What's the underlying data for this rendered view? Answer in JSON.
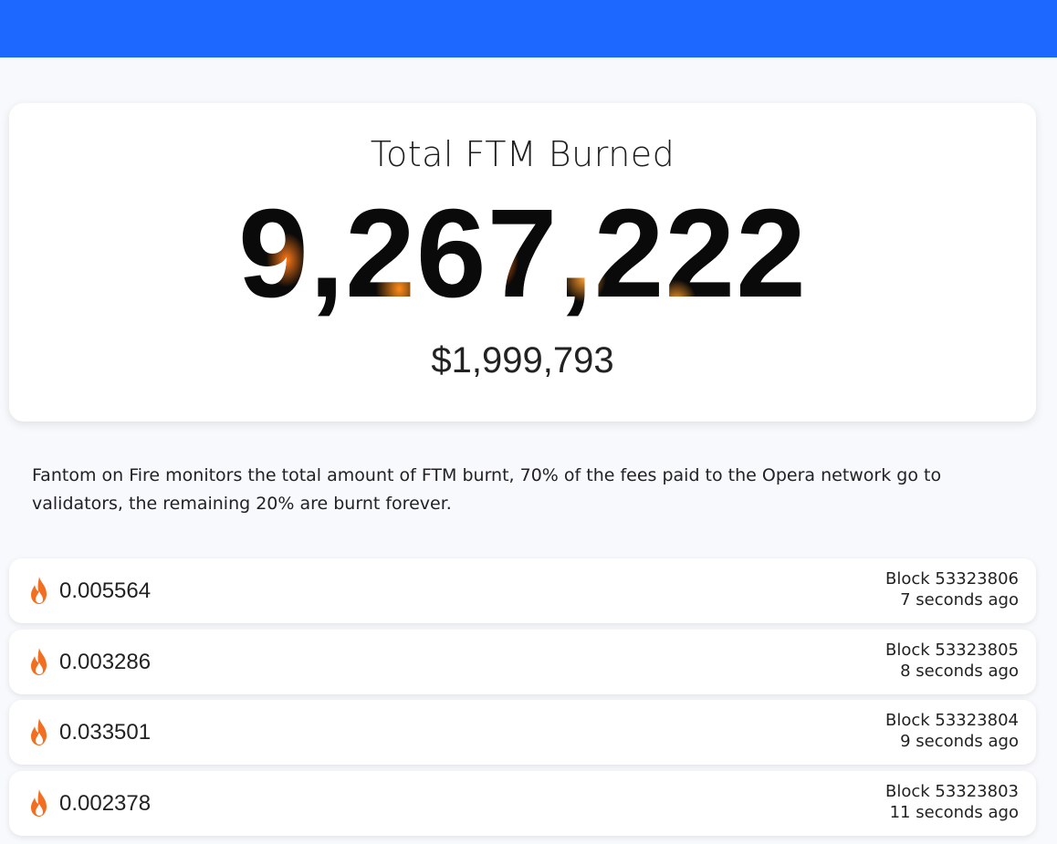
{
  "hero": {
    "title": "Total FTM Burned",
    "total": "9,267,222",
    "usd": "$1,999,793"
  },
  "description": "Fantom on Fire monitors the total amount of FTM burnt, 70% of the fees paid to the Opera network go to validators, the remaining 20% are burnt forever.",
  "burns": [
    {
      "amount": "0.005564",
      "block": "Block 53323806",
      "ago": "7 seconds ago"
    },
    {
      "amount": "0.003286",
      "block": "Block 53323805",
      "ago": "8 seconds ago"
    },
    {
      "amount": "0.033501",
      "block": "Block 53323804",
      "ago": "9 seconds ago"
    },
    {
      "amount": "0.002378",
      "block": "Block 53323803",
      "ago": "11 seconds ago"
    }
  ],
  "icons": {
    "burn": "flame-icon"
  },
  "colors": {
    "topbar": "#1d68fe",
    "flame": "#f26f21"
  }
}
